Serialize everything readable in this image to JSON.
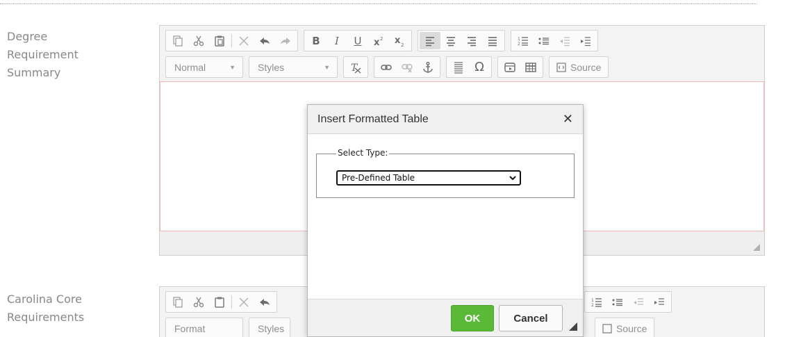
{
  "form": {
    "field1_label_lines": [
      "Degree",
      "Requirement",
      "Summary"
    ],
    "field2_label_lines": [
      "Carolina Core",
      "Requirements"
    ]
  },
  "toolbar": {
    "format_combo": "Normal",
    "styles_combo": "Styles",
    "source_label": "Source"
  },
  "toolbar2": {
    "format_combo": "Format",
    "styles_combo": "Styles",
    "source_label": "Source"
  },
  "dialog": {
    "title": "Insert Formatted Table",
    "select_type_legend": "Select Type:",
    "select_value": "Pre-Defined Table",
    "ok_label": "OK",
    "cancel_label": "Cancel"
  },
  "colors": {
    "ok_green": "#5ab937",
    "content_border": "#f2b8b8"
  }
}
